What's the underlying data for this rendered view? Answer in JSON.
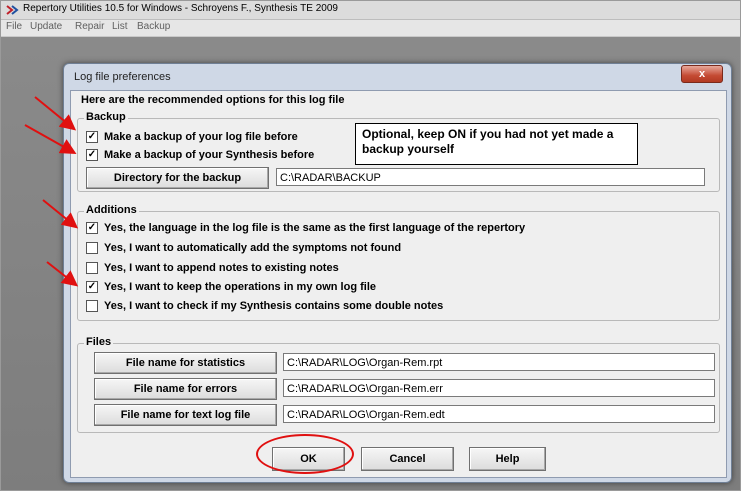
{
  "window": {
    "title": "Repertory Utilities 10.5 for Windows - Schroyens F., Synthesis TE 2009"
  },
  "menu": [
    "File",
    "Update",
    "Repair",
    "List",
    "Backup"
  ],
  "dialog": {
    "title": "Log file preferences",
    "close_label": "x",
    "intro": "Here are the recommended options for this log file",
    "backup": {
      "label": "Backup",
      "options": [
        {
          "label": "Make a backup of your log file before",
          "checked": "☑"
        },
        {
          "label": "Make a backup of your Synthesis before",
          "checked": "☑"
        }
      ],
      "dir_button": "Directory for the backup",
      "dir_value": "C:\\RADAR\\BACKUP",
      "note": "Optional, keep ON if you had not yet made a backup yourself"
    },
    "additions": {
      "label": "Additions",
      "options": [
        {
          "label": "Yes, the language in the log file is the same as the first language of the repertory",
          "checked": true
        },
        {
          "label": "Yes, I want to automatically add the symptoms not found",
          "checked": false
        },
        {
          "label": "Yes, I want to append notes to existing notes",
          "checked": false
        },
        {
          "label": "Yes, I want to keep the operations in my own log file",
          "checked": true
        },
        {
          "label": "Yes, I want to check if my Synthesis contains some double notes",
          "checked": false
        }
      ]
    },
    "files": {
      "label": "Files",
      "rows": [
        {
          "button": "File name for statistics",
          "value": "C:\\RADAR\\LOG\\Organ-Rem.rpt"
        },
        {
          "button": "File name for errors",
          "value": "C:\\RADAR\\LOG\\Organ-Rem.err"
        },
        {
          "button": "File name for text log file",
          "value": "C:\\RADAR\\LOG\\Organ-Rem.edt"
        }
      ]
    },
    "buttons": {
      "ok": "OK",
      "cancel": "Cancel",
      "help": "Help"
    }
  },
  "colors": {
    "annotation": "#e01010",
    "dialog_frame": "#cfd8e6"
  }
}
